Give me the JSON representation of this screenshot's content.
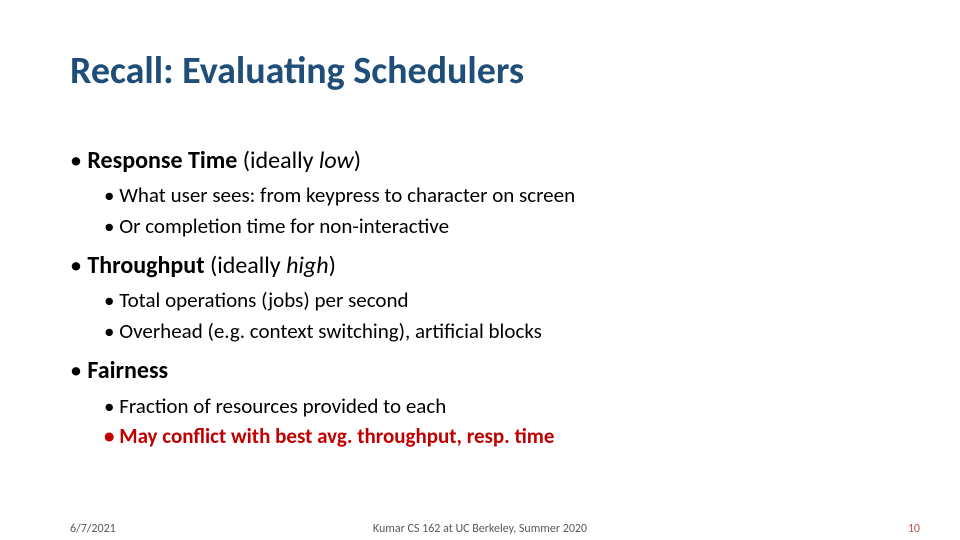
{
  "title": "Recall: Evaluating Schedulers",
  "items": [
    {
      "label": "Response Time",
      "paren_prefix": " (ideally ",
      "ideal": "low",
      "paren_suffix": ")",
      "subs": [
        "What user sees: from keypress to character on screen",
        "Or completion time for non-interactive"
      ]
    },
    {
      "label": "Throughput",
      "paren_prefix": " (ideally ",
      "ideal": "high",
      "paren_suffix": ")",
      "subs": [
        "Total operations (jobs) per second",
        "Overhead (e.g. context switching), artificial blocks"
      ]
    },
    {
      "label": "Fairness",
      "paren_prefix": "",
      "ideal": "",
      "paren_suffix": "",
      "subs": [
        "Fraction of resources provided to each"
      ],
      "subs_highlight": [
        "May conflict with best avg. throughput, resp. time"
      ]
    }
  ],
  "footer": {
    "date": "6/7/2021",
    "course": "Kumar CS 162 at UC Berkeley, Summer 2020",
    "page": "10"
  }
}
